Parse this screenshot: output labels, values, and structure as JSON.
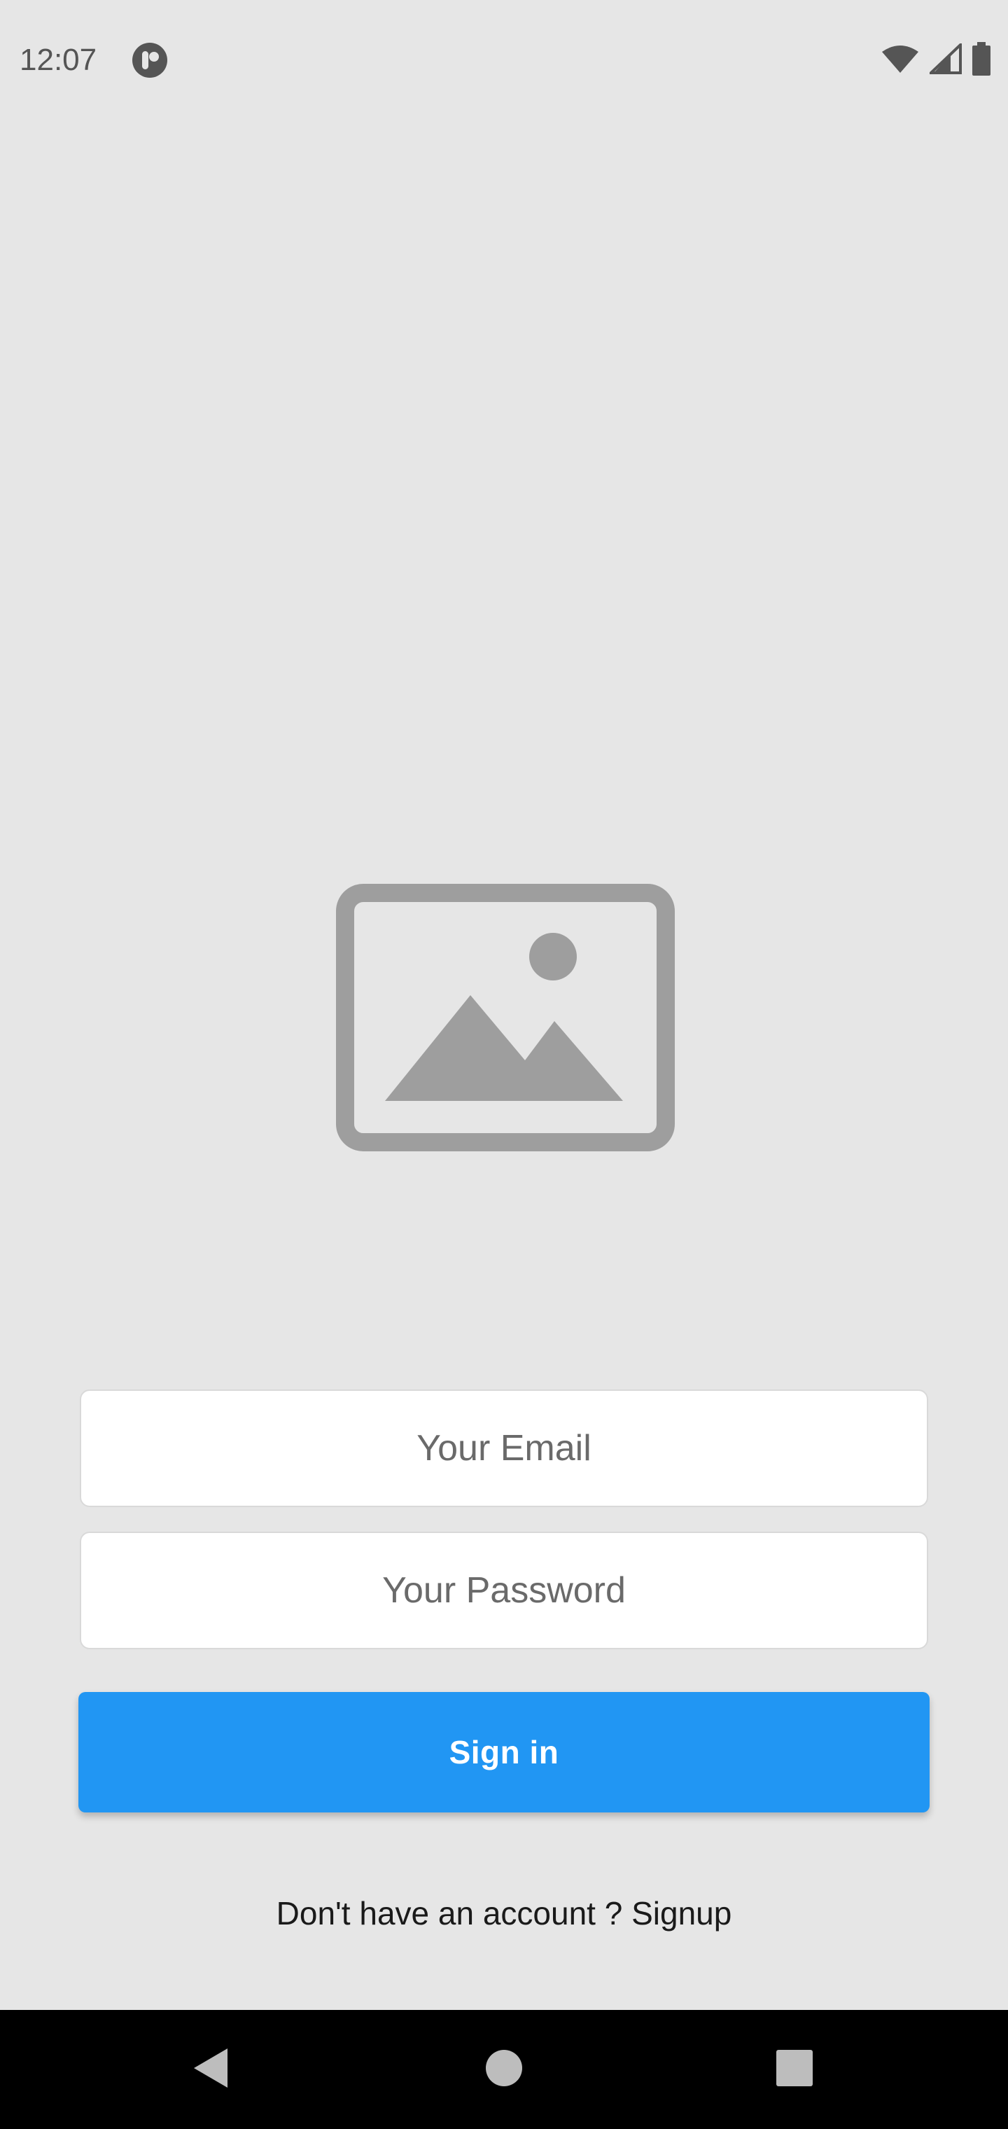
{
  "status_bar": {
    "time": "12:07",
    "app_icon": "app-notification-icon",
    "icons": [
      "wifi-icon",
      "cellular-signal-icon",
      "battery-icon"
    ]
  },
  "hero": {
    "icon": "image-placeholder-icon"
  },
  "form": {
    "email_placeholder": "Your Email",
    "email_value": "",
    "password_placeholder": "Your Password",
    "password_value": "",
    "signin_label": "Sign in",
    "signup_text": "Don't have an account ? Signup"
  },
  "nav_bar": {
    "icons": [
      "back-icon",
      "home-icon",
      "recents-icon"
    ]
  },
  "colors": {
    "background": "#e6e6e6",
    "accent": "#2196f3",
    "placeholder_graphic": "#9e9e9e",
    "nav_bar": "#000000"
  }
}
